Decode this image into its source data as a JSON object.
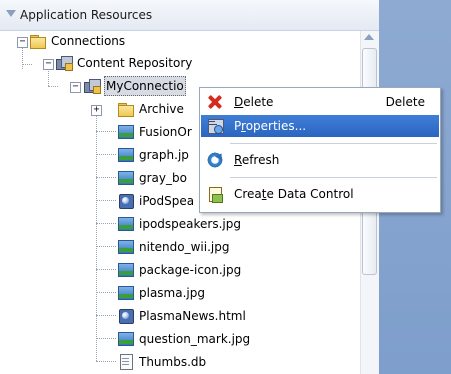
{
  "panel": {
    "title": "Application Resources"
  },
  "tree": {
    "connections": "Connections",
    "content_repository": "Content Repository",
    "my_connection": "MyConnectio",
    "archive": "Archive",
    "items": [
      {
        "label": "FusionOr",
        "icon": "image-icon"
      },
      {
        "label": "graph.jp",
        "icon": "image-icon"
      },
      {
        "label": "gray_bo",
        "icon": "image-icon"
      },
      {
        "label": "iPodSpea",
        "icon": "html-icon"
      },
      {
        "label": "ipodspeakers.jpg",
        "icon": "image-icon"
      },
      {
        "label": "nitendo_wii.jpg",
        "icon": "image-icon"
      },
      {
        "label": "package-icon.jpg",
        "icon": "image-icon"
      },
      {
        "label": "plasma.jpg",
        "icon": "image-icon"
      },
      {
        "label": "PlasmaNews.html",
        "icon": "html-icon"
      },
      {
        "label": "question_mark.jpg",
        "icon": "image-icon"
      },
      {
        "label": "Thumbs.db",
        "icon": "document-icon"
      }
    ]
  },
  "context_menu": {
    "delete": {
      "pre": "",
      "mn": "D",
      "post": "elete",
      "shortcut": "Delete"
    },
    "properties": {
      "pre": "P",
      "mn": "r",
      "post": "operties..."
    },
    "refresh": {
      "pre": "",
      "mn": "R",
      "post": "efresh"
    },
    "create_data_control": {
      "pre": "Crea",
      "mn": "t",
      "post": "e Data Control"
    }
  },
  "colors": {
    "highlight": "#2b66c0",
    "right_pane": "#7e9ecb",
    "delete_icon": "#d62b1f"
  }
}
